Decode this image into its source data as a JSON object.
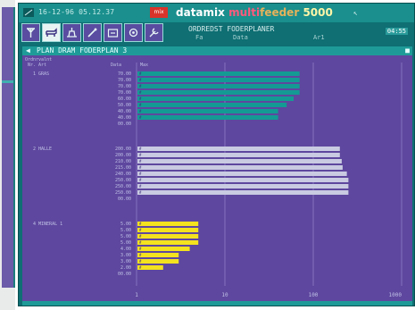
{
  "device": {
    "datetime": "16-12-96  05.12.37",
    "brand_prefix": "datamix",
    "brand_multi": "multi",
    "brand_model": "feeder",
    "brand_version": "5000",
    "logo_text": "mix"
  },
  "info": {
    "line1": "ORDREDST FODERPLANER",
    "sub1": "Fa",
    "sub2": "Data",
    "sub3": "Ar1",
    "battery": "04:55"
  },
  "window": {
    "title": "PLAN DRAM FODERPLAN  3"
  },
  "toolbar": {
    "tools": [
      "antenna-icon",
      "cow-icon",
      "feed-icon",
      "edit-icon",
      "mixer-icon",
      "settings-icon",
      "tools-icon"
    ]
  },
  "colors": {
    "background": "#5e479e",
    "teal": "#149a94",
    "silver": "#c9cbe2",
    "yellow": "#f4e21f",
    "grid": "#8e7ec8",
    "text": "#bfc0e6"
  },
  "chart_data": {
    "type": "bar",
    "orientation": "horizontal",
    "x_scale": "log",
    "xlim": [
      1,
      1000
    ],
    "x_ticks": [
      "1",
      "10",
      "100",
      "1000"
    ],
    "header_left": "Ordnrvalnt",
    "header_col1": "Nr. Art",
    "header_col2": "Data",
    "header_col3": "Max",
    "groups": [
      {
        "name": "1 GRAS",
        "color": "#149a94",
        "values_label": [
          "70.00",
          "70.00",
          "70.00",
          "70.00",
          "60.00",
          "50.00",
          "40.00",
          "40.00"
        ],
        "values": [
          70,
          70,
          70,
          70,
          60,
          50,
          40,
          40
        ],
        "trailing_label": "00.00"
      },
      {
        "name": "2 HALLE",
        "color": "#c9cbe2",
        "values_label": [
          "200.00",
          "200.00",
          "210.00",
          "215.00",
          "240.00",
          "250.00",
          "250.00",
          "250.00"
        ],
        "values": [
          200,
          200,
          210,
          215,
          240,
          250,
          250,
          250
        ],
        "trailing_label": "00.00"
      },
      {
        "name": "4 MINERAL 1",
        "color": "#f4e21f",
        "values_label": [
          "5.00",
          "5.00",
          "5.00",
          "5.00",
          "4.00",
          "3.00",
          "3.00",
          "2.00"
        ],
        "values": [
          5,
          5,
          5,
          5,
          4,
          3,
          3,
          2
        ],
        "trailing_label": "00.00"
      }
    ]
  }
}
